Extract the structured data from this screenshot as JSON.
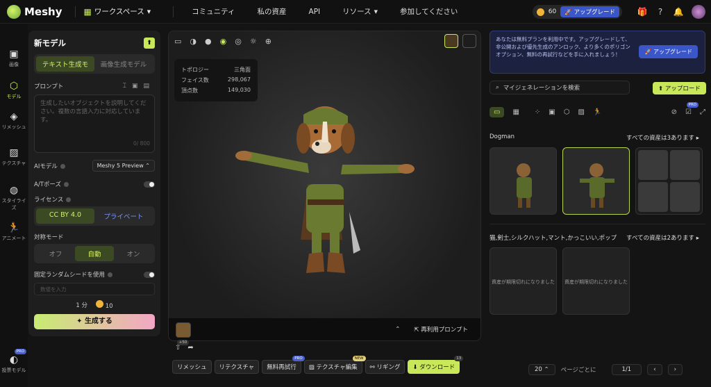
{
  "topbar": {
    "brand": "Meshy",
    "workspace": "ワークスペース",
    "nav": [
      "コミュニティ",
      "私の資産",
      "API",
      "リソース",
      "参加してください"
    ],
    "credits": "60",
    "upgrade": "アップグレード"
  },
  "sidebar": [
    {
      "label": "画像",
      "icon": "image-icon"
    },
    {
      "label": "モデル",
      "icon": "cube-icon"
    },
    {
      "label": "リメッシュ",
      "icon": "remesh-icon"
    },
    {
      "label": "テクスチャ",
      "icon": "texture-icon"
    },
    {
      "label": "スタイライズ",
      "icon": "stylize-icon"
    },
    {
      "label": "アニメート",
      "icon": "animate-icon"
    },
    {
      "label": "投票モデル",
      "icon": "vote-icon",
      "badge": "PRO"
    }
  ],
  "left": {
    "title": "新モデル",
    "tabs": [
      "テキスト生成モ",
      "画像生成モデル"
    ],
    "prompt_label": "プロンプト",
    "prompt_placeholder": "生成したいオブジェクトを説明してください。複数の言語入力に対応しています。",
    "counter": "0/ 800",
    "ai_model_label": "AIモデル",
    "ai_model_value": "Meshy 5 Preview",
    "atpose_label": "A/Tポーズ",
    "license_label": "ライセンス",
    "license_opts": [
      "CC BY 4.0",
      "プライベート"
    ],
    "sym_label": "対称モード",
    "sym_opts": [
      "オフ",
      "自動",
      "オン"
    ],
    "seed_label": "固定ランダムシードを使用",
    "seed_placeholder": "数値を入力",
    "time": "1 分",
    "cost": "10",
    "generate": "生成する"
  },
  "viewer": {
    "stats": [
      {
        "k": "トポロジー",
        "v": "三角面"
      },
      {
        "k": "フェイス数",
        "v": "298,067"
      },
      {
        "k": "頂点数",
        "v": "149,030"
      }
    ],
    "reuse": "再利用プロンプト",
    "plus": "+50"
  },
  "actions": [
    {
      "label": "リメッシュ"
    },
    {
      "label": "リテクスチャ"
    },
    {
      "label": "無料再試行",
      "badge": "PRO"
    },
    {
      "label": "テクスチャ編集",
      "badge": "NEW"
    },
    {
      "label": "リギング"
    },
    {
      "label": "ダウンロード",
      "badge": "13"
    }
  ],
  "right": {
    "banner": "あなたは無料プランを利用中です。アップグレードして、非公開および優先生成のアンロック、より多くのポリゴンオプション、無料の再試行などを手に入れましょう！",
    "banner_btn": "アップグレード",
    "search_placeholder": "マイジェネレーションを検索",
    "upload": "アップロード",
    "pro": "PRO",
    "group1": {
      "title": "Dogman",
      "all": "すべての資産は3あります"
    },
    "group2": {
      "title": "猫,剣士,シルクハット,マント,かっこいい,ポップ",
      "all": "すべての資産は2あります"
    },
    "failed": "資産が期限切れになりました",
    "page_size": "20",
    "per_page": "ページごとに",
    "page": "1/1"
  }
}
